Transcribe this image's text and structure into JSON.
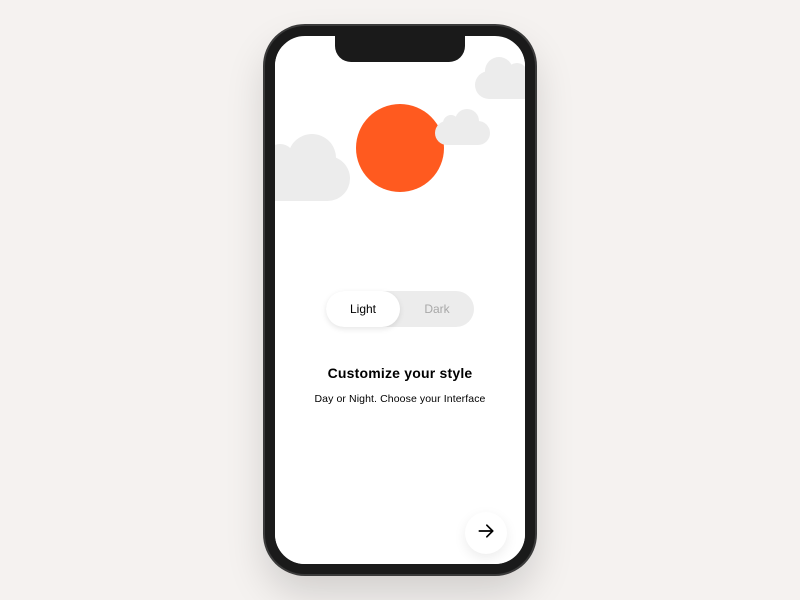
{
  "theme_toggle": {
    "options": [
      "Light",
      "Dark"
    ],
    "selected_index": 0
  },
  "content": {
    "heading": "Customize your style",
    "subheading": "Day or Night. Choose your Interface"
  },
  "colors": {
    "accent": "#ff5a1f",
    "cloud": "#ececec",
    "background": "#f5f2f0"
  }
}
